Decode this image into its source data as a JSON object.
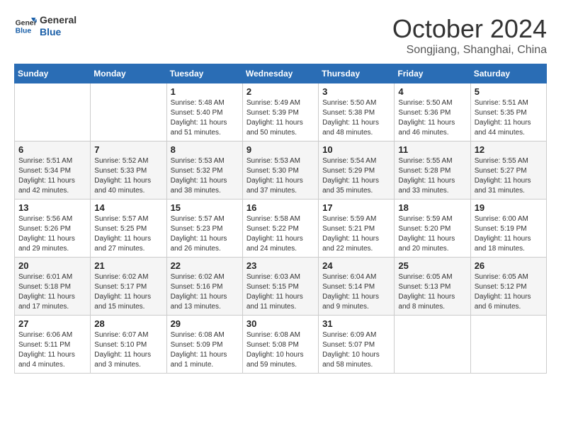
{
  "header": {
    "logo_general": "General",
    "logo_blue": "Blue",
    "month": "October 2024",
    "location": "Songjiang, Shanghai, China"
  },
  "days_of_week": [
    "Sunday",
    "Monday",
    "Tuesday",
    "Wednesday",
    "Thursday",
    "Friday",
    "Saturday"
  ],
  "weeks": [
    [
      {
        "day": "",
        "info": ""
      },
      {
        "day": "",
        "info": ""
      },
      {
        "day": "1",
        "info": "Sunrise: 5:48 AM\nSunset: 5:40 PM\nDaylight: 11 hours and 51 minutes."
      },
      {
        "day": "2",
        "info": "Sunrise: 5:49 AM\nSunset: 5:39 PM\nDaylight: 11 hours and 50 minutes."
      },
      {
        "day": "3",
        "info": "Sunrise: 5:50 AM\nSunset: 5:38 PM\nDaylight: 11 hours and 48 minutes."
      },
      {
        "day": "4",
        "info": "Sunrise: 5:50 AM\nSunset: 5:36 PM\nDaylight: 11 hours and 46 minutes."
      },
      {
        "day": "5",
        "info": "Sunrise: 5:51 AM\nSunset: 5:35 PM\nDaylight: 11 hours and 44 minutes."
      }
    ],
    [
      {
        "day": "6",
        "info": "Sunrise: 5:51 AM\nSunset: 5:34 PM\nDaylight: 11 hours and 42 minutes."
      },
      {
        "day": "7",
        "info": "Sunrise: 5:52 AM\nSunset: 5:33 PM\nDaylight: 11 hours and 40 minutes."
      },
      {
        "day": "8",
        "info": "Sunrise: 5:53 AM\nSunset: 5:32 PM\nDaylight: 11 hours and 38 minutes."
      },
      {
        "day": "9",
        "info": "Sunrise: 5:53 AM\nSunset: 5:30 PM\nDaylight: 11 hours and 37 minutes."
      },
      {
        "day": "10",
        "info": "Sunrise: 5:54 AM\nSunset: 5:29 PM\nDaylight: 11 hours and 35 minutes."
      },
      {
        "day": "11",
        "info": "Sunrise: 5:55 AM\nSunset: 5:28 PM\nDaylight: 11 hours and 33 minutes."
      },
      {
        "day": "12",
        "info": "Sunrise: 5:55 AM\nSunset: 5:27 PM\nDaylight: 11 hours and 31 minutes."
      }
    ],
    [
      {
        "day": "13",
        "info": "Sunrise: 5:56 AM\nSunset: 5:26 PM\nDaylight: 11 hours and 29 minutes."
      },
      {
        "day": "14",
        "info": "Sunrise: 5:57 AM\nSunset: 5:25 PM\nDaylight: 11 hours and 27 minutes."
      },
      {
        "day": "15",
        "info": "Sunrise: 5:57 AM\nSunset: 5:23 PM\nDaylight: 11 hours and 26 minutes."
      },
      {
        "day": "16",
        "info": "Sunrise: 5:58 AM\nSunset: 5:22 PM\nDaylight: 11 hours and 24 minutes."
      },
      {
        "day": "17",
        "info": "Sunrise: 5:59 AM\nSunset: 5:21 PM\nDaylight: 11 hours and 22 minutes."
      },
      {
        "day": "18",
        "info": "Sunrise: 5:59 AM\nSunset: 5:20 PM\nDaylight: 11 hours and 20 minutes."
      },
      {
        "day": "19",
        "info": "Sunrise: 6:00 AM\nSunset: 5:19 PM\nDaylight: 11 hours and 18 minutes."
      }
    ],
    [
      {
        "day": "20",
        "info": "Sunrise: 6:01 AM\nSunset: 5:18 PM\nDaylight: 11 hours and 17 minutes."
      },
      {
        "day": "21",
        "info": "Sunrise: 6:02 AM\nSunset: 5:17 PM\nDaylight: 11 hours and 15 minutes."
      },
      {
        "day": "22",
        "info": "Sunrise: 6:02 AM\nSunset: 5:16 PM\nDaylight: 11 hours and 13 minutes."
      },
      {
        "day": "23",
        "info": "Sunrise: 6:03 AM\nSunset: 5:15 PM\nDaylight: 11 hours and 11 minutes."
      },
      {
        "day": "24",
        "info": "Sunrise: 6:04 AM\nSunset: 5:14 PM\nDaylight: 11 hours and 9 minutes."
      },
      {
        "day": "25",
        "info": "Sunrise: 6:05 AM\nSunset: 5:13 PM\nDaylight: 11 hours and 8 minutes."
      },
      {
        "day": "26",
        "info": "Sunrise: 6:05 AM\nSunset: 5:12 PM\nDaylight: 11 hours and 6 minutes."
      }
    ],
    [
      {
        "day": "27",
        "info": "Sunrise: 6:06 AM\nSunset: 5:11 PM\nDaylight: 11 hours and 4 minutes."
      },
      {
        "day": "28",
        "info": "Sunrise: 6:07 AM\nSunset: 5:10 PM\nDaylight: 11 hours and 3 minutes."
      },
      {
        "day": "29",
        "info": "Sunrise: 6:08 AM\nSunset: 5:09 PM\nDaylight: 11 hours and 1 minute."
      },
      {
        "day": "30",
        "info": "Sunrise: 6:08 AM\nSunset: 5:08 PM\nDaylight: 10 hours and 59 minutes."
      },
      {
        "day": "31",
        "info": "Sunrise: 6:09 AM\nSunset: 5:07 PM\nDaylight: 10 hours and 58 minutes."
      },
      {
        "day": "",
        "info": ""
      },
      {
        "day": "",
        "info": ""
      }
    ]
  ]
}
